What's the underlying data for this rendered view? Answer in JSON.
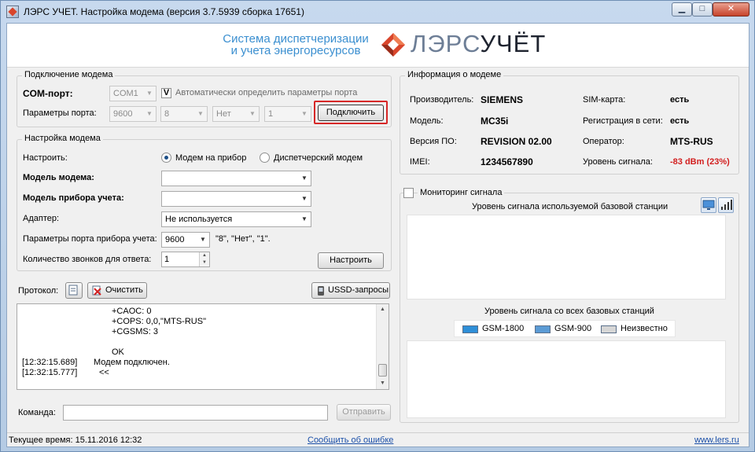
{
  "window": {
    "title": "ЛЭРС УЧЕТ. Настройка модема (версия 3.7.5939 сборка 17651)",
    "controls": {
      "minimize": "▁",
      "maximize": "□",
      "close": "✕"
    }
  },
  "header": {
    "tagline_1": "Система диспетчеризации",
    "tagline_2": "и учета энергоресурсов",
    "logo_a": "ЛЭРС",
    "logo_b": "УЧЁТ"
  },
  "connection": {
    "group_title": "Подключение модема",
    "com_port_label": "COM-порт:",
    "com_port_value": "COM1",
    "auto_detect_checked": "V",
    "auto_detect_label": "Автоматически определить параметры порта",
    "port_params_label": "Параметры порта:",
    "baud": "9600",
    "data_bits": "8",
    "parity": "Нет",
    "stop_bits": "1",
    "connect_button": "Подключить"
  },
  "modem_setup": {
    "group_title": "Настройка модема",
    "configure_label": "Настроить:",
    "radio_device": "Модем на прибор",
    "radio_dispatch": "Диспетчерский модем",
    "modem_model_label": "Модель модема:",
    "modem_model_value": "",
    "meter_model_label": "Модель прибора учета:",
    "meter_model_value": "",
    "adapter_label": "Адаптер:",
    "adapter_value": "Не используется",
    "meter_port_label": "Параметры порта прибора учета:",
    "meter_port_value": "9600",
    "meter_port_hint": "\"8\", \"Нет\", \"1\".",
    "rings_label": "Количество звонков для ответа:",
    "rings_value": "1",
    "configure_button": "Настроить"
  },
  "protocol": {
    "label": "Протокол:",
    "clear_button": "Очистить",
    "ussd_button": "USSD-запросы",
    "lines": [
      {
        "time": "",
        "text": "+CAOC: 0"
      },
      {
        "time": "",
        "text": "+COPS: 0,0,\"MTS-RUS\""
      },
      {
        "time": "",
        "text": "+CGSMS: 3"
      },
      {
        "time": "",
        "text": ""
      },
      {
        "time": "",
        "text": "OK"
      },
      {
        "time": "[12:32:15.689]",
        "text": "Модем подключен."
      },
      {
        "time": "[12:32:15.777]",
        "text": "<<"
      }
    ]
  },
  "command": {
    "label": "Команда:",
    "value": "",
    "send_button": "Отправить"
  },
  "modem_info": {
    "group_title": "Информация о модеме",
    "manufacturer_label": "Производитель:",
    "manufacturer": "SIEMENS",
    "model_label": "Модель:",
    "model": "MC35i",
    "firmware_label": "Версия ПО:",
    "firmware": "REVISION 02.00",
    "imei_label": "IMEI:",
    "imei": "1234567890",
    "sim_label": "SIM-карта:",
    "sim": "есть",
    "registration_label": "Регистрация в сети:",
    "registration": "есть",
    "operator_label": "Оператор:",
    "operator": "MTS-RUS",
    "signal_label": "Уровень сигнала:",
    "signal": "-83 dBm (23%)",
    "signal_color": "#d21f1f"
  },
  "monitoring": {
    "checkbox_label": "Мониторинг сигнала",
    "chart1_title": "Уровень сигнала используемой базовой станции",
    "chart2_title": "Уровень сигнала со всех базовых станций",
    "legend": [
      {
        "label": "GSM-1800",
        "color": "#2f8fd8"
      },
      {
        "label": "GSM-900",
        "color": "#5b9bd5"
      },
      {
        "label": "Неизвестно",
        "color": "#d6d6d6"
      }
    ],
    "view_icons": [
      "monitor-icon",
      "signal-bars-icon"
    ]
  },
  "status": {
    "time": "Текущее время: 15.11.2016 12:32",
    "report_link": "Сообщить об ошибке",
    "site_link": "www.lers.ru"
  }
}
